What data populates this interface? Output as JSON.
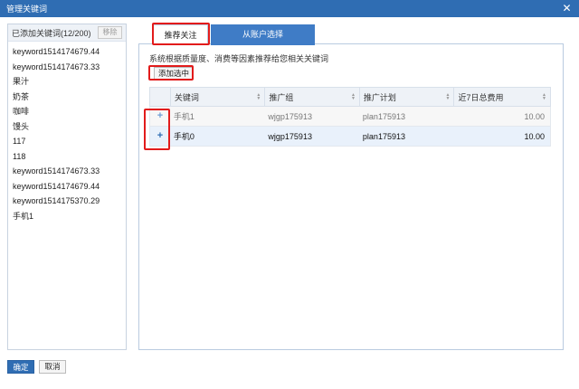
{
  "window": {
    "title": "管理关键词",
    "close_glyph": "✕"
  },
  "left": {
    "count_label": "已添加关键词(12/200)",
    "remove_label": "移除",
    "keywords": [
      "keyword1514174679.44",
      "keyword1514174673.33",
      "果汁",
      "奶茶",
      "咖啡",
      "馒头",
      "117",
      "118",
      "keyword1514174673.33",
      "keyword1514174679.44",
      "keyword1514175370.29",
      "手机1"
    ]
  },
  "tabs": [
    {
      "label": "推荐关注",
      "active": true
    },
    {
      "label": "从账户选择",
      "active": false
    }
  ],
  "description": "系统根据质量度、消费等因素推荐给您相关关键词",
  "add_selected_label": "添加选中",
  "table": {
    "columns": [
      "关键词",
      "推广组",
      "推广计划",
      "近7日总费用"
    ],
    "rows": [
      {
        "add": "+",
        "keyword": "手机1",
        "group": "wjgp175913",
        "plan": "plan175913",
        "cost": "10.00",
        "state": "added"
      },
      {
        "add": "+",
        "keyword": "手机0",
        "group": "wjgp175913",
        "plan": "plan175913",
        "cost": "10.00",
        "state": "selected"
      }
    ]
  },
  "footer": {
    "confirm_label": "确定",
    "cancel_label": "取消"
  },
  "colors": {
    "titlebar": "#2f6db3",
    "tab_active_bg": "#ffffff",
    "tab_inactive_bg": "#3f7cc6",
    "highlight": "#e21b1b"
  }
}
